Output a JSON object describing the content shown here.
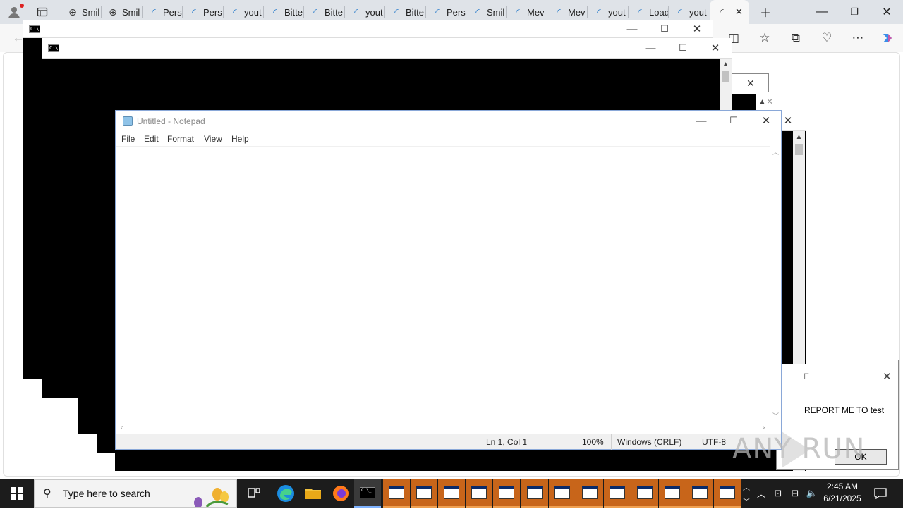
{
  "browser": {
    "tabs": [
      {
        "label": "Smil",
        "icon": "globe-icon"
      },
      {
        "label": "Smil",
        "icon": "globe-icon"
      },
      {
        "label": "Pers",
        "icon": "loading-icon"
      },
      {
        "label": "Pers",
        "icon": "loading-icon"
      },
      {
        "label": "yout",
        "icon": "loading-icon"
      },
      {
        "label": "Bitte",
        "icon": "loading-icon"
      },
      {
        "label": "Bitte",
        "icon": "loading-icon"
      },
      {
        "label": "yout",
        "icon": "loading-icon"
      },
      {
        "label": "Bitte",
        "icon": "loading-icon"
      },
      {
        "label": "Pers",
        "icon": "loading-icon"
      },
      {
        "label": "Smil",
        "icon": "loading-icon"
      },
      {
        "label": "Mev",
        "icon": "loading-icon"
      },
      {
        "label": "Mev",
        "icon": "loading-icon"
      },
      {
        "label": "yout",
        "icon": "loading-icon"
      },
      {
        "label": "Load",
        "icon": "loading-icon"
      },
      {
        "label": "yout",
        "icon": "loading-icon"
      }
    ]
  },
  "notepad": {
    "title": "Untitled - Notepad",
    "menu": [
      "File",
      "Edit",
      "Format",
      "View",
      "Help"
    ],
    "status": {
      "position": "Ln 1, Col 1",
      "zoom": "100%",
      "line_endings": "Windows (CRLF)",
      "encoding": "UTF-8"
    }
  },
  "dialog": {
    "title_fragment": "E",
    "message": "REPORT ME TO test",
    "ok_label": "OK"
  },
  "watermark": "ANY RUN",
  "taskbar": {
    "search_placeholder": "Type here to search",
    "time": "2:45 AM",
    "date": "6/21/2025",
    "window_buttons": 13
  }
}
